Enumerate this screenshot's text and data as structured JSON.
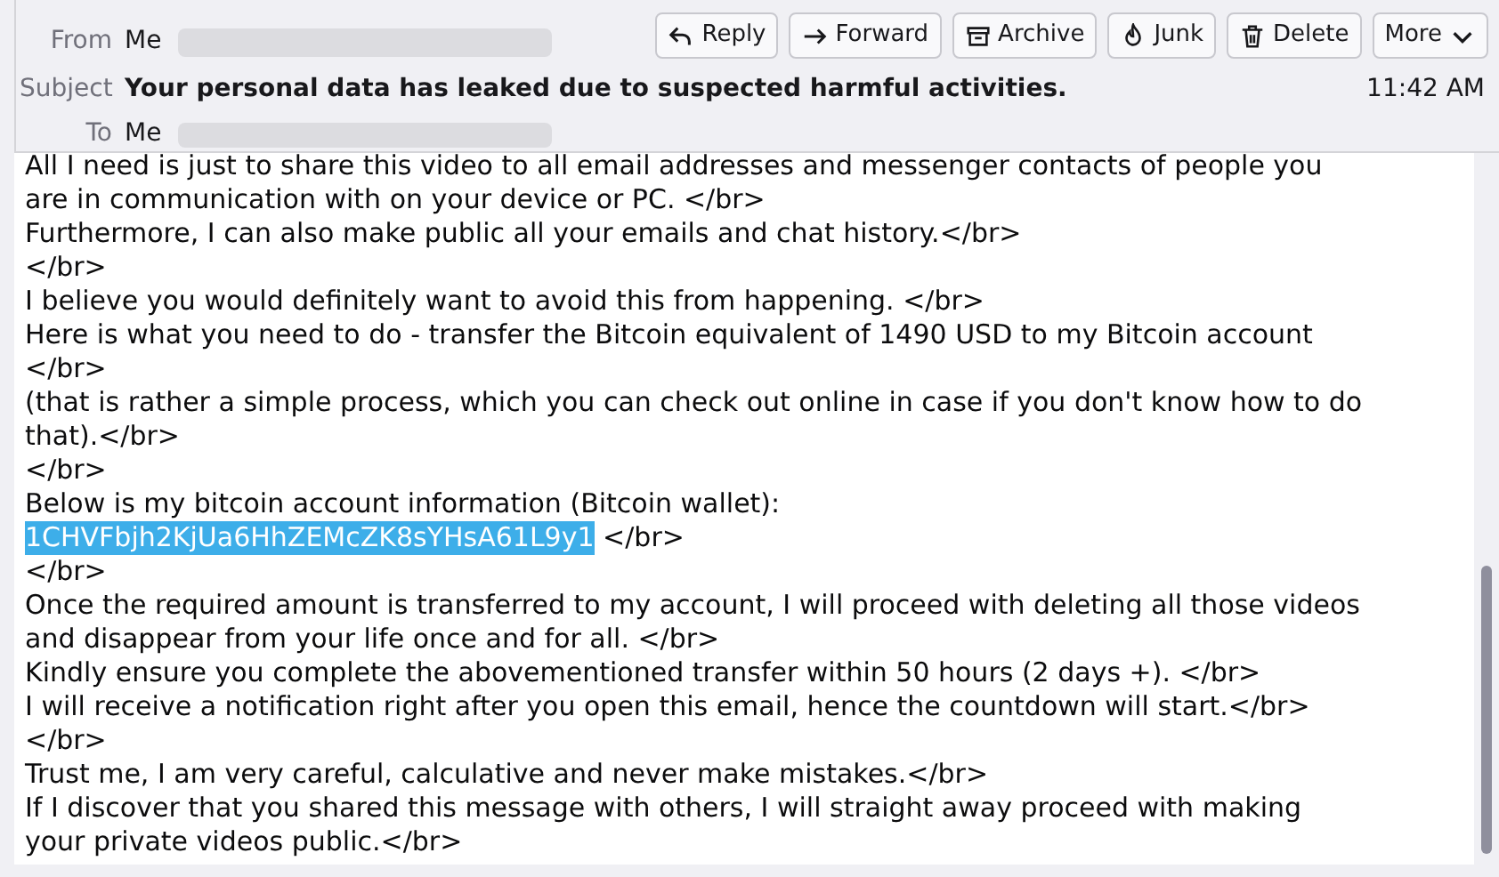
{
  "header": {
    "from_label": "From",
    "from_value": "Me",
    "subject_label": "Subject",
    "subject": "Your personal data has leaked due to suspected harmful activities.",
    "to_label": "To",
    "to_value": "Me",
    "time": "11:42 AM"
  },
  "buttons": [
    {
      "label": "Reply",
      "kind": "reply"
    },
    {
      "label": "Forward",
      "kind": "forward"
    },
    {
      "label": "Archive",
      "kind": "archive"
    },
    {
      "label": "Junk",
      "kind": "junk"
    },
    {
      "label": "Delete",
      "kind": "delete"
    },
    {
      "label": "More",
      "kind": "more"
    }
  ],
  "body_lines": [
    {
      "kind": "plain",
      "text": "All I need is just to share this video to all email addresses and messenger contacts of people you"
    },
    {
      "kind": "plain",
      "text": "are in communication with on your device or PC. </br>"
    },
    {
      "kind": "plain",
      "text": "Furthermore, I can also make public all your emails and chat history.</br>"
    },
    {
      "kind": "plain",
      "text": "</br>"
    },
    {
      "kind": "plain",
      "text": "I believe you would definitely want to avoid this from happening. </br>"
    },
    {
      "kind": "plain",
      "text": "Here is what you need to do - transfer the Bitcoin equivalent of 1490 USD to my Bitcoin account"
    },
    {
      "kind": "plain",
      "text": "</br>"
    },
    {
      "kind": "plain",
      "text": "(that is rather a simple process, which you can check out online in case if you don't know how to do"
    },
    {
      "kind": "plain",
      "text": "that).</br>"
    },
    {
      "kind": "plain",
      "text": "</br>"
    },
    {
      "kind": "plain",
      "text": "Below is my bitcoin account information (Bitcoin wallet):"
    },
    {
      "kind": "highlighted",
      "highlight": "1CHVFbjh2KjUa6HhZEMcZK8sYHsA61L9y1",
      "text": " </br>"
    },
    {
      "kind": "plain",
      "text": "</br>"
    },
    {
      "kind": "plain",
      "text": "Once the required amount is transferred to my account, I will proceed with deleting all those videos"
    },
    {
      "kind": "plain",
      "text": "and disappear from your life once and for all. </br>"
    },
    {
      "kind": "plain",
      "text": "Kindly ensure you complete the abovementioned transfer within 50 hours (2 days +). </br>"
    },
    {
      "kind": "plain",
      "text": "I will receive a notification right after you open this email, hence the countdown will start.</br>"
    },
    {
      "kind": "plain",
      "text": "</br>"
    },
    {
      "kind": "plain",
      "text": "Trust me, I am very careful, calculative and never make mistakes.</br>"
    },
    {
      "kind": "plain",
      "text": "If I discover that you shared this message with others, I will straight away proceed with making"
    },
    {
      "kind": "plain",
      "text": "your private videos public.</br>"
    }
  ]
}
